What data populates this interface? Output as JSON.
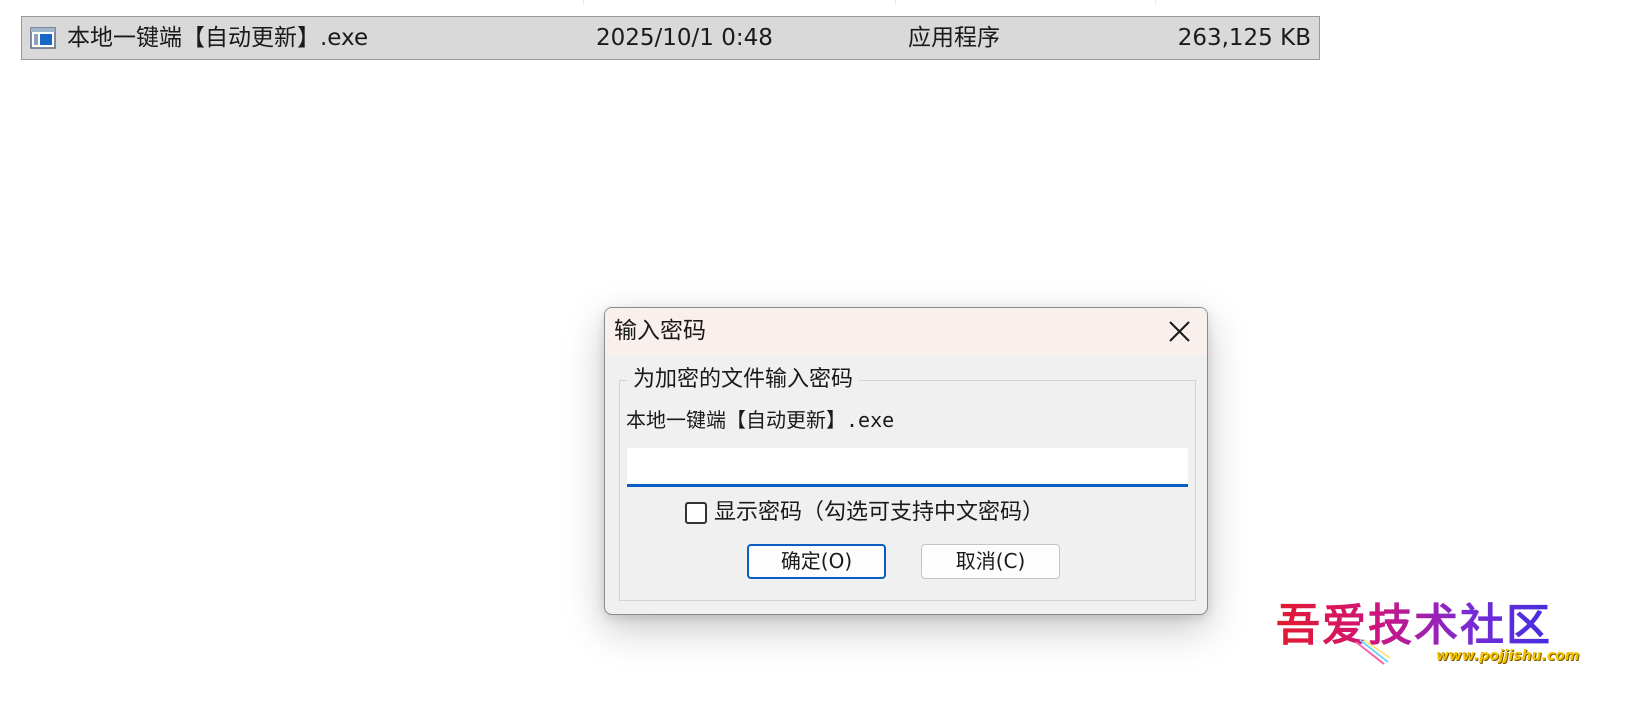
{
  "file_row": {
    "name": "本地一键端【自动更新】.exe",
    "date_modified": "2025/10/1 0:48",
    "type": "应用程序",
    "size": "263,125 KB",
    "icon": "exe-file-icon"
  },
  "dialog": {
    "title": "输入密码",
    "close_icon": "close-icon",
    "group_label": "为加密的文件输入密码",
    "file_label": "本地一键端【自动更新】.exe",
    "password_value": "",
    "show_password_label": "显示密码（勾选可支持中文密码）",
    "show_password_checked": false,
    "ok_label": "确定(O)",
    "cancel_label": "取消(C)"
  },
  "watermark": {
    "text": "吾爱技术社区",
    "url": "www.pojjishu.com"
  },
  "colors": {
    "selection_bg": "#d9d9d9",
    "titlebar_bg": "#f9efec",
    "dialog_bg": "#f0f0f0",
    "accent": "#0a5dc2",
    "watermark_red": "#e41a2b",
    "watermark_blue": "#3f2fe0",
    "watermark_gold": "#f2c200"
  }
}
